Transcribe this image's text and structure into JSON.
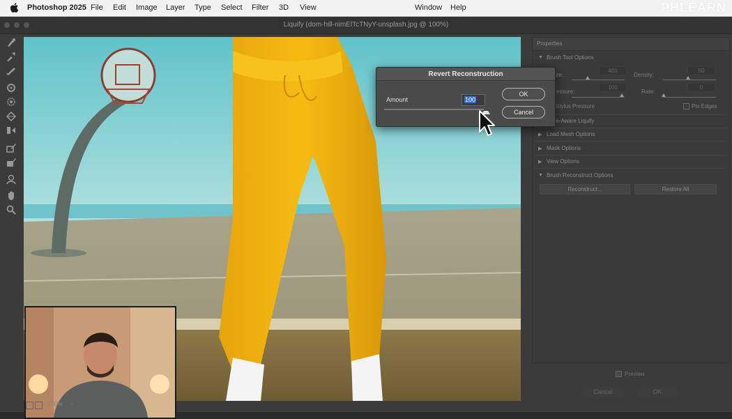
{
  "menubar": {
    "app": "Photoshop 2025",
    "items": [
      "File",
      "Edit",
      "Image",
      "Layer",
      "Type",
      "Select",
      "Filter",
      "3D",
      "View"
    ],
    "window": "Window",
    "help": "Help",
    "brand": "PHLEARN"
  },
  "window": {
    "title": "Liquify (dom-hill-nimElTcTNyY-unsplash.jpg @ 100%)"
  },
  "status": {
    "zoom": "100%"
  },
  "panel": {
    "title": "Properties",
    "brush_tool_options": "Brush Tool Options",
    "size_label": "Size:",
    "size_value": "400",
    "density_label": "Density:",
    "density_value": "50",
    "pressure_label": "Pressure:",
    "pressure_value": "100",
    "rate_label": "Rate:",
    "rate_value": "0",
    "stylus_pressure": "Stylus Pressure",
    "pin_edges": "Pin Edges",
    "face_aware": "Face-Aware Liquify",
    "load_mesh": "Load Mesh Options",
    "mask_options": "Mask Options",
    "view_options": "View Options",
    "brush_reconstruct": "Brush Reconstruct Options",
    "reconstruct_button": "Reconstruct...",
    "restore_all_button": "Restore All",
    "preview_label": "Preview",
    "cancel_button": "Cancel",
    "ok_button": "OK"
  },
  "dialog": {
    "title": "Revert Reconstruction",
    "amount_label": "Amount",
    "amount_value": "100",
    "ok_button": "OK",
    "cancel_button": "Cancel",
    "amount_fraction": 1.0
  },
  "colors": {
    "menubar_bg": "#f2f2f2",
    "window_bg": "#3b3b3b",
    "dialog_bg": "#4a4a4a",
    "selection": "#2f6fd3",
    "pants": "#f2b40e"
  }
}
